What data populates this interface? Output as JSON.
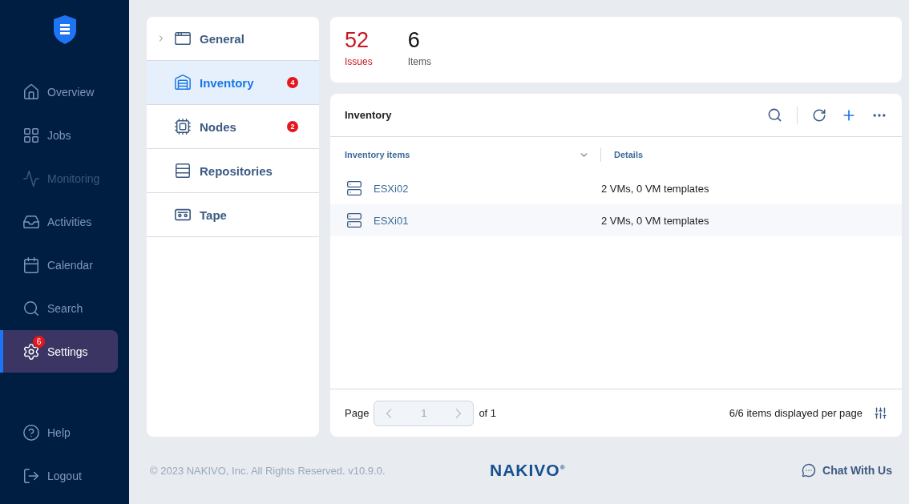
{
  "sidebar": {
    "items": [
      {
        "label": "Overview",
        "selected": false,
        "disabled": false
      },
      {
        "label": "Jobs",
        "selected": false,
        "disabled": false
      },
      {
        "label": "Monitoring",
        "selected": false,
        "disabled": true
      },
      {
        "label": "Activities",
        "selected": false,
        "disabled": false
      },
      {
        "label": "Calendar",
        "selected": false,
        "disabled": false
      },
      {
        "label": "Search",
        "selected": false,
        "disabled": false
      },
      {
        "label": "Settings",
        "selected": true,
        "disabled": false,
        "badge": "6"
      }
    ],
    "bottom_items": [
      {
        "label": "Help"
      },
      {
        "label": "Logout"
      }
    ]
  },
  "settings_menu": {
    "items": [
      {
        "label": "General",
        "kind": "group",
        "selected": false
      },
      {
        "label": "Inventory",
        "kind": "page",
        "selected": true,
        "badge": "4"
      },
      {
        "label": "Nodes",
        "kind": "page",
        "selected": false,
        "badge": "2"
      },
      {
        "label": "Repositories",
        "kind": "page",
        "selected": false
      },
      {
        "label": "Tape",
        "kind": "page",
        "selected": false
      }
    ]
  },
  "stats": [
    {
      "value": "52",
      "label": "Issues",
      "kind": "alert"
    },
    {
      "value": "6",
      "label": "Items",
      "kind": "normal"
    }
  ],
  "inventory": {
    "title": "Inventory",
    "table": {
      "columns": [
        "Inventory items",
        "Details"
      ],
      "rows": [
        {
          "name": "ESXi02",
          "details": "2 VMs, 0 VM templates"
        },
        {
          "name": "ESXi01",
          "details": "2 VMs, 0 VM templates"
        }
      ]
    },
    "pagination": {
      "label": "Page",
      "value": "1",
      "total": "of 1",
      "summary": "6/6 items displayed per page"
    }
  },
  "footer": {
    "copyright": "© 2023 NAKIVO, Inc. All Rights Reserved. v10.9.0.",
    "logo": "NAKIVO$^{®}$",
    "chat": "Chat With Us"
  }
}
